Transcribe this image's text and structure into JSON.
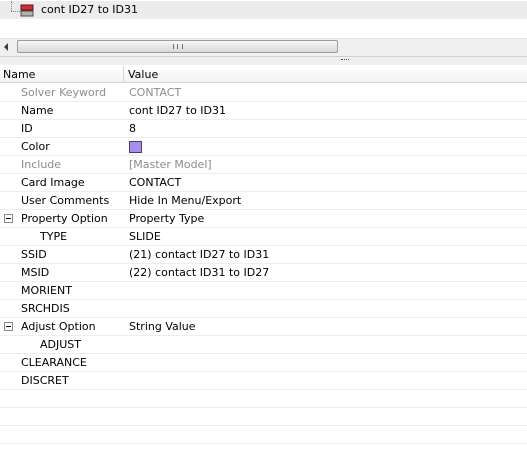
{
  "tree": {
    "item_label": "cont ID27 to ID31",
    "item_icon": "contact-icon"
  },
  "grid": {
    "columns": {
      "name": "Name",
      "value": "Value"
    },
    "rows": [
      {
        "name": "Solver Keyword",
        "value": "CONTACT",
        "disabled": true
      },
      {
        "name": "Name",
        "value": "cont ID27 to ID31"
      },
      {
        "name": "ID",
        "value": "8"
      },
      {
        "name": "Color",
        "value": "",
        "color": "#a58ef0"
      },
      {
        "name": "Include",
        "value": "[Master Model]",
        "disabled": true
      },
      {
        "name": "Card Image",
        "value": "CONTACT"
      },
      {
        "name": "User Comments",
        "value": "Hide In Menu/Export"
      },
      {
        "name": "Property Option",
        "value": "Property Type",
        "group": true
      },
      {
        "name": "TYPE",
        "value": "SLIDE",
        "child": true
      },
      {
        "name": "SSID",
        "value": "(21) contact ID27 to ID31"
      },
      {
        "name": "MSID",
        "value": "(22) contact ID31 to ID27"
      },
      {
        "name": "MORIENT",
        "value": ""
      },
      {
        "name": "SRCHDIS",
        "value": ""
      },
      {
        "name": "Adjust Option",
        "value": "String Value",
        "group": true
      },
      {
        "name": "ADJUST",
        "value": "",
        "child": true
      },
      {
        "name": "CLEARANCE",
        "value": ""
      },
      {
        "name": "DISCRET",
        "value": ""
      },
      {
        "name": "",
        "value": ""
      },
      {
        "name": "",
        "value": ""
      },
      {
        "name": "",
        "value": ""
      }
    ]
  }
}
